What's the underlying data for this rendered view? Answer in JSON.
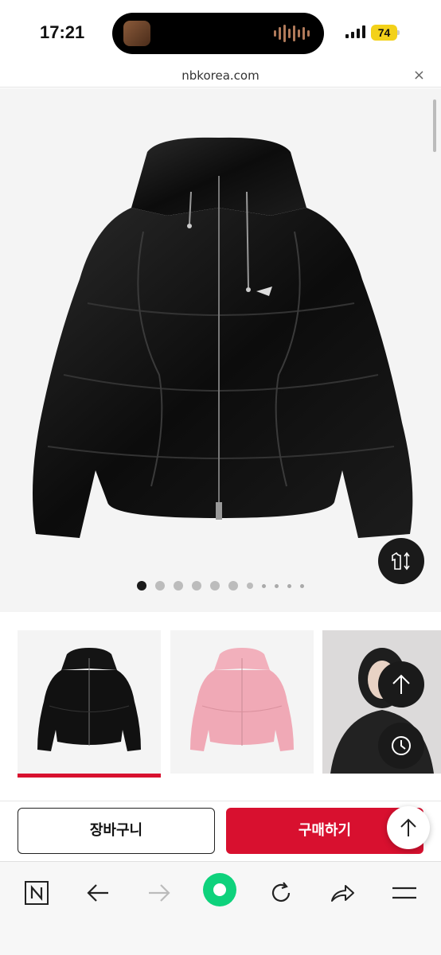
{
  "status_bar": {
    "time": "17:21",
    "battery": "74"
  },
  "url_bar": {
    "url": "nbkorea.com",
    "close_icon": "×"
  },
  "hero": {
    "product_brand_mark": "new balance",
    "carousel_total": 11,
    "carousel_active": 1,
    "fit_icon": "t-shirt-size-icon"
  },
  "thumbnails": [
    {
      "label": "black-jacket",
      "color": "#111111",
      "selected": true
    },
    {
      "label": "pink-jacket",
      "color": "#f0a9b6",
      "selected": false
    },
    {
      "label": "model-photo",
      "color": "#1d1d1d",
      "selected": false
    }
  ],
  "buttons": {
    "cart": "장바구니",
    "buy": "구매하기"
  },
  "colors": {
    "accent": "#d8102f",
    "dark": "#1a1a1a"
  },
  "toolbar": {
    "items": [
      "naver-n-icon",
      "back-arrow-icon",
      "forward-arrow-icon",
      "green-dot-icon",
      "reload-icon",
      "share-icon",
      "menu-icon"
    ]
  }
}
